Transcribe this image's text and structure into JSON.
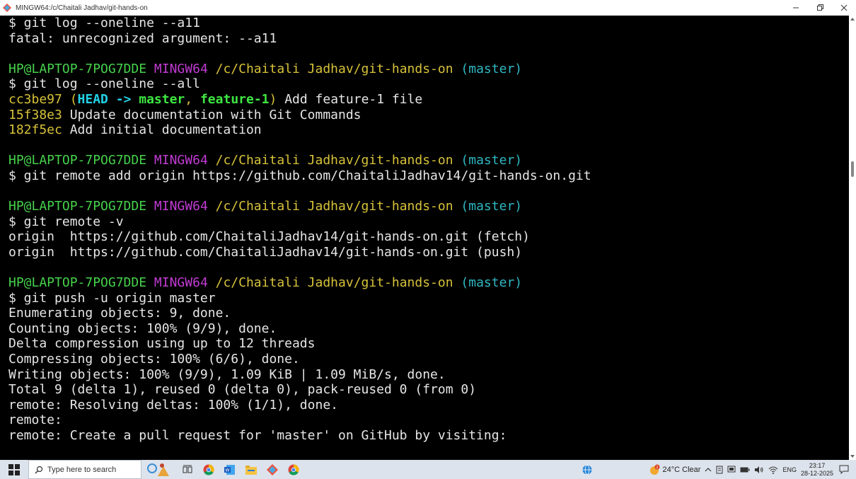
{
  "window": {
    "title": "MINGW64:/c/Chaitali Jadhav/git-hands-on",
    "accent_colors": {
      "prompt_user": "#46d24b",
      "prompt_mingw": "#c23bd4",
      "prompt_path": "#d7c23a",
      "prompt_branch": "#2fb8c3"
    }
  },
  "terminal": {
    "lines": [
      {
        "segments": [
          {
            "t": "$ git log --oneline --a11",
            "c": "white"
          }
        ]
      },
      {
        "segments": [
          {
            "t": "fatal: unrecognized argument: --a11",
            "c": "white"
          }
        ]
      },
      {
        "segments": [
          {
            "t": "",
            "c": "white"
          }
        ]
      },
      {
        "segments": [
          {
            "t": "HP@LAPTOP-7POG7DDE",
            "c": "green"
          },
          {
            "t": " ",
            "c": "white"
          },
          {
            "t": "MINGW64",
            "c": "magenta"
          },
          {
            "t": " ",
            "c": "white"
          },
          {
            "t": "/c/Chaitali Jadhav/git-hands-on",
            "c": "yellow"
          },
          {
            "t": " ",
            "c": "white"
          },
          {
            "t": "(master)",
            "c": "cyan"
          }
        ]
      },
      {
        "segments": [
          {
            "t": "$ git log --oneline --all",
            "c": "white"
          }
        ]
      },
      {
        "segments": [
          {
            "t": "cc3be97",
            "c": "yellow"
          },
          {
            "t": " ",
            "c": "white"
          },
          {
            "t": "(",
            "c": "yellow"
          },
          {
            "t": "HEAD -> ",
            "c": "cyanb"
          },
          {
            "t": "master",
            "c": "greenb"
          },
          {
            "t": ", ",
            "c": "yellow"
          },
          {
            "t": "feature-1",
            "c": "greenb"
          },
          {
            "t": ")",
            "c": "yellow"
          },
          {
            "t": " Add feature-1 file",
            "c": "white"
          }
        ]
      },
      {
        "segments": [
          {
            "t": "15f38e3",
            "c": "yellow"
          },
          {
            "t": " Update documentation with Git Commands",
            "c": "white"
          }
        ]
      },
      {
        "segments": [
          {
            "t": "182f5ec",
            "c": "yellow"
          },
          {
            "t": " Add initial documentation",
            "c": "white"
          }
        ]
      },
      {
        "segments": [
          {
            "t": "",
            "c": "white"
          }
        ]
      },
      {
        "segments": [
          {
            "t": "HP@LAPTOP-7POG7DDE",
            "c": "green"
          },
          {
            "t": " ",
            "c": "white"
          },
          {
            "t": "MINGW64",
            "c": "magenta"
          },
          {
            "t": " ",
            "c": "white"
          },
          {
            "t": "/c/Chaitali Jadhav/git-hands-on",
            "c": "yellow"
          },
          {
            "t": " ",
            "c": "white"
          },
          {
            "t": "(master)",
            "c": "cyan"
          }
        ]
      },
      {
        "segments": [
          {
            "t": "$ git remote add origin https://github.com/ChaitaliJadhav14/git-hands-on.git",
            "c": "white"
          }
        ]
      },
      {
        "segments": [
          {
            "t": "",
            "c": "white"
          }
        ]
      },
      {
        "segments": [
          {
            "t": "HP@LAPTOP-7POG7DDE",
            "c": "green"
          },
          {
            "t": " ",
            "c": "white"
          },
          {
            "t": "MINGW64",
            "c": "magenta"
          },
          {
            "t": " ",
            "c": "white"
          },
          {
            "t": "/c/Chaitali Jadhav/git-hands-on",
            "c": "yellow"
          },
          {
            "t": " ",
            "c": "white"
          },
          {
            "t": "(master)",
            "c": "cyan"
          }
        ]
      },
      {
        "segments": [
          {
            "t": "$ git remote -v",
            "c": "white"
          }
        ]
      },
      {
        "segments": [
          {
            "t": "origin  https://github.com/ChaitaliJadhav14/git-hands-on.git (fetch)",
            "c": "white"
          }
        ]
      },
      {
        "segments": [
          {
            "t": "origin  https://github.com/ChaitaliJadhav14/git-hands-on.git (push)",
            "c": "white"
          }
        ]
      },
      {
        "segments": [
          {
            "t": "",
            "c": "white"
          }
        ]
      },
      {
        "segments": [
          {
            "t": "HP@LAPTOP-7POG7DDE",
            "c": "green"
          },
          {
            "t": " ",
            "c": "white"
          },
          {
            "t": "MINGW64",
            "c": "magenta"
          },
          {
            "t": " ",
            "c": "white"
          },
          {
            "t": "/c/Chaitali Jadhav/git-hands-on",
            "c": "yellow"
          },
          {
            "t": " ",
            "c": "white"
          },
          {
            "t": "(master)",
            "c": "cyan"
          }
        ]
      },
      {
        "segments": [
          {
            "t": "$ git push -u origin master",
            "c": "white"
          }
        ]
      },
      {
        "segments": [
          {
            "t": "Enumerating objects: 9, done.",
            "c": "white"
          }
        ]
      },
      {
        "segments": [
          {
            "t": "Counting objects: 100% (9/9), done.",
            "c": "white"
          }
        ]
      },
      {
        "segments": [
          {
            "t": "Delta compression using up to 12 threads",
            "c": "white"
          }
        ]
      },
      {
        "segments": [
          {
            "t": "Compressing objects: 100% (6/6), done.",
            "c": "white"
          }
        ]
      },
      {
        "segments": [
          {
            "t": "Writing objects: 100% (9/9), 1.09 KiB | 1.09 MiB/s, done.",
            "c": "white"
          }
        ]
      },
      {
        "segments": [
          {
            "t": "Total 9 (delta 1), reused 0 (delta 0), pack-reused 0 (from 0)",
            "c": "white"
          }
        ]
      },
      {
        "segments": [
          {
            "t": "remote: Resolving deltas: 100% (1/1), done.",
            "c": "white"
          }
        ]
      },
      {
        "segments": [
          {
            "t": "remote:",
            "c": "white"
          }
        ]
      },
      {
        "segments": [
          {
            "t": "remote: Create a pull request for 'master' on GitHub by visiting:",
            "c": "white"
          }
        ]
      }
    ]
  },
  "taskbar": {
    "search_placeholder": "Type here to search",
    "weather": "24°C  Clear",
    "language": "ENG",
    "time": "23:17",
    "date": "28-12-2025",
    "weather_badge": "2"
  }
}
